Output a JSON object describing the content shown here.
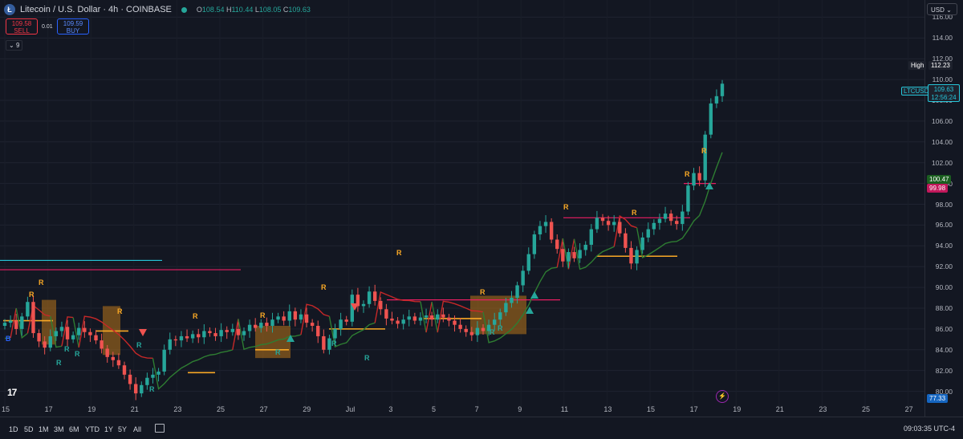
{
  "header": {
    "title": "Litecoin / U.S. Dollar · 4h · COINBASE",
    "open_label": "O",
    "open": "108.54",
    "high_label": "H",
    "high": "110.44",
    "low_label": "L",
    "low": "108.05",
    "close_label": "C",
    "close": "109.63"
  },
  "trade": {
    "sell_price": "109.58",
    "sell_label": "SELL",
    "spread": "0.01",
    "buy_price": "109.59",
    "buy_label": "BUY"
  },
  "indicator_toggle": "9",
  "currency_button": "USD",
  "price_axis": {
    "ticks": [
      "116.00",
      "114.00",
      "112.00",
      "110.00",
      "108.00",
      "106.00",
      "104.00",
      "102.00",
      "100.00",
      "98.00",
      "96.00",
      "94.00",
      "92.00",
      "90.00",
      "88.00",
      "86.00",
      "84.00",
      "82.00",
      "80.00"
    ]
  },
  "price_labels": {
    "high_label": "High",
    "high_value": "112.23",
    "symbol": "LTCUSD",
    "last_price": "109.63",
    "countdown": "12:56:24",
    "green_level": "100.47",
    "red_level": "99.98",
    "low_value": "77.33"
  },
  "time_axis": {
    "labels": [
      "15",
      "17",
      "19",
      "21",
      "23",
      "25",
      "27",
      "29",
      "Jul",
      "3",
      "5",
      "7",
      "9",
      "11",
      "13",
      "15",
      "17",
      "19",
      "21",
      "23",
      "25",
      "27"
    ]
  },
  "ranges": [
    "1D",
    "5D",
    "1M",
    "3M",
    "6M",
    "YTD",
    "1Y",
    "5Y",
    "All"
  ],
  "clock": "09:03:35 UTC-4",
  "colors": {
    "background": "#131722",
    "up": "#26a69a",
    "down": "#ef5350",
    "trail_green": "#2e7d32",
    "trail_red": "#c62828",
    "signal_orange": "#f9a825",
    "zone_fill": "#b8741a",
    "pink_line": "#e91e63",
    "cyan_line": "#26c6da"
  },
  "chart_data": {
    "type": "candlestick",
    "title": "Litecoin / U.S. Dollar · 4h · COINBASE",
    "ylim": [
      78.5,
      117.5
    ],
    "x_labels": [
      "15",
      "17",
      "19",
      "21",
      "23",
      "25",
      "27",
      "29",
      "Jul",
      "3",
      "5",
      "7",
      "9",
      "11",
      "13",
      "15",
      "17",
      "19",
      "21",
      "23",
      "25",
      "27"
    ],
    "close_series": [
      86.6,
      86.8,
      86.0,
      87.2,
      88.6,
      85.6,
      84.8,
      84.2,
      85.3,
      85.8,
      86.2,
      85.0,
      85.4,
      86.1,
      85.7,
      85.4,
      84.9,
      84.1,
      83.3,
      83.0,
      82.5,
      81.6,
      80.7,
      79.8,
      80.6,
      81.3,
      81.6,
      81.9,
      84.0,
      85.0,
      84.9,
      85.3,
      85.1,
      85.5,
      85.2,
      85.8,
      85.6,
      85.3,
      85.9,
      85.7,
      86.0,
      85.4,
      85.8,
      86.4,
      86.1,
      86.6,
      86.3,
      86.9,
      87.2,
      86.8,
      87.7,
      86.9,
      87.4,
      86.6,
      86.3,
      85.3,
      84.0,
      85.1,
      86.0,
      86.9,
      86.7,
      89.3,
      88.2,
      88.4,
      89.6,
      88.7,
      87.9,
      87.0,
      86.8,
      86.5,
      86.9,
      87.2,
      86.8,
      87.1,
      87.3,
      86.9,
      87.4,
      87.1,
      86.8,
      86.4,
      86.0,
      85.7,
      85.4,
      86.1,
      85.8,
      86.4,
      86.9,
      87.6,
      88.5,
      89.0,
      90.2,
      91.6,
      93.2,
      95.1,
      95.9,
      96.3,
      94.6,
      93.7,
      92.5,
      93.4,
      92.8,
      93.6,
      94.1,
      95.6,
      96.7,
      96.4,
      96.0,
      96.3,
      95.2,
      93.8,
      92.3,
      93.6,
      94.8,
      95.6,
      96.2,
      96.6,
      97.1,
      96.4,
      96.1,
      97.3,
      99.8,
      101.0,
      100.3,
      104.7,
      107.7,
      108.4,
      109.6
    ]
  }
}
